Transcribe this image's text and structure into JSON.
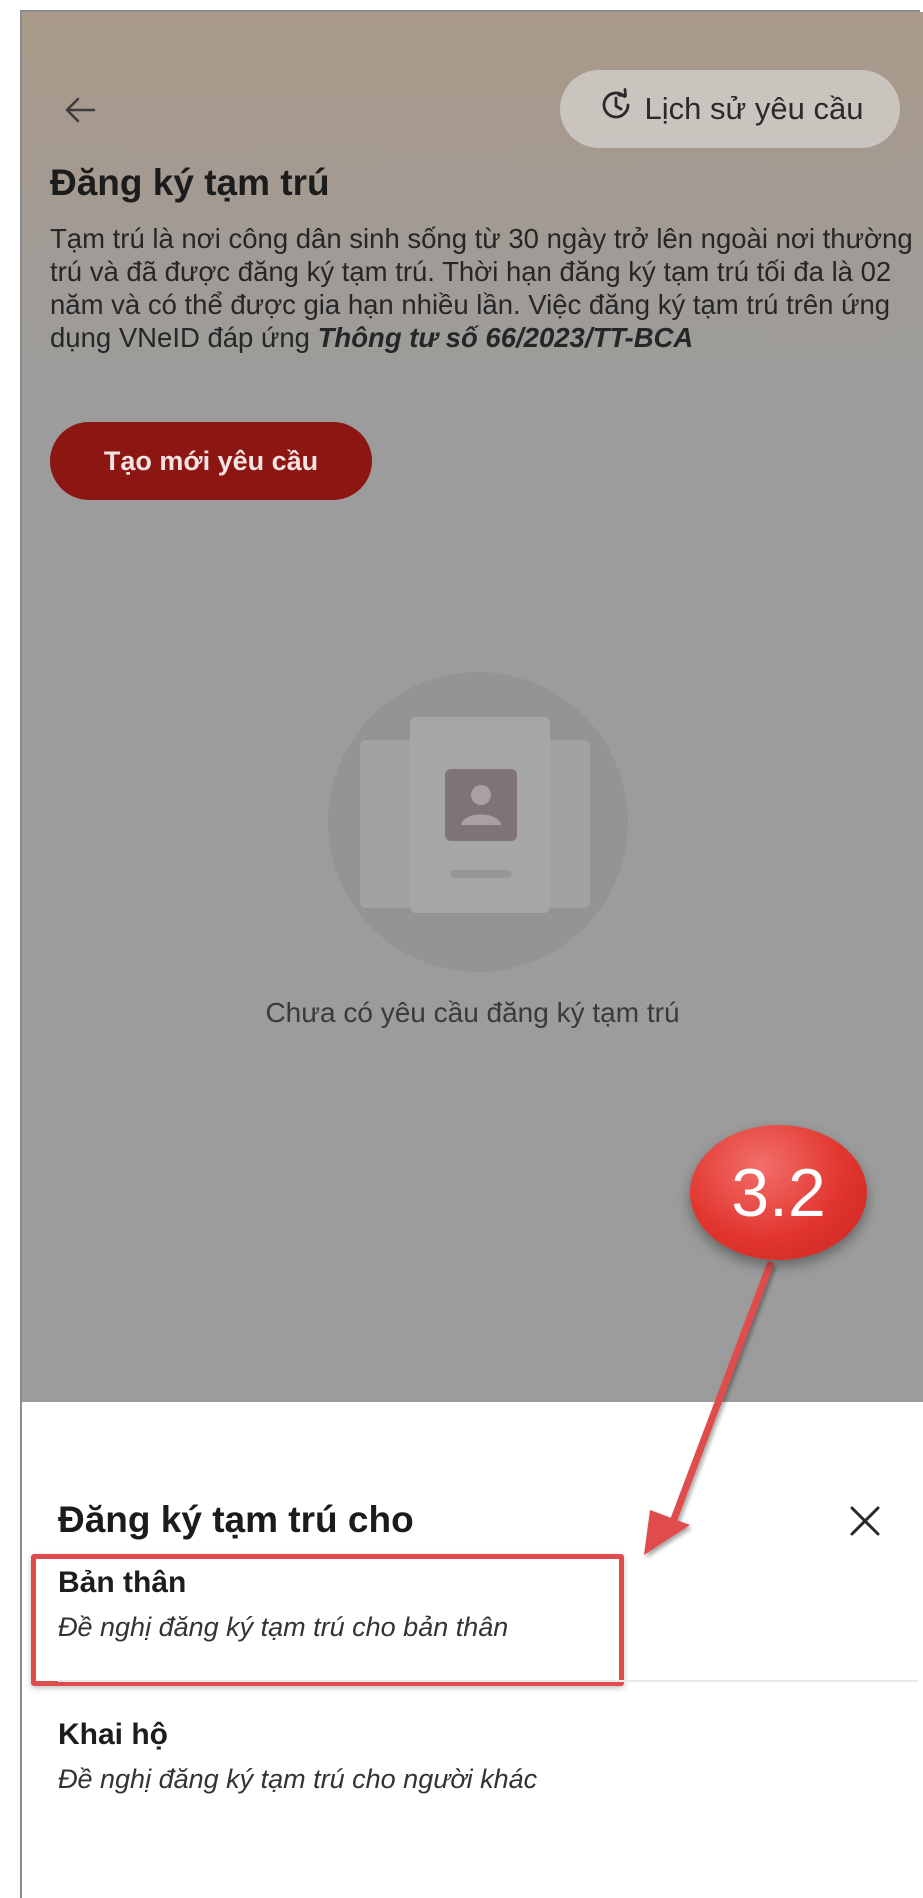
{
  "header": {
    "back_icon": "arrow-left-icon",
    "history_icon": "history-clock-icon",
    "history_label": "Lịch sử yêu cầu"
  },
  "page": {
    "title": "Đăng ký tạm trú",
    "description_plain": "Tạm trú là nơi công dân sinh sống từ 30 ngày trở lên ngoài nơi thường trú và đã được đăng ký tạm trú. Thời hạn đăng ký tạm trú tối đa là 02 năm và có thể được gia hạn nhiều lần. Việc đăng ký tạm trú trên ứng dụng VNeID đáp ứng",
    "description_bold": "Thông tư số 66/2023/TT-BCA",
    "create_button": "Tạo mới yêu cầu",
    "empty_state_icon": "id-card-icon",
    "empty_state_text": "Chưa có yêu cầu đăng ký tạm trú"
  },
  "sheet": {
    "title": "Đăng ký tạm trú cho",
    "close_icon": "close-icon",
    "options": [
      {
        "title": "Bản thân",
        "subtitle": "Đề nghị đăng ký tạm trú cho bản thân"
      },
      {
        "title": "Khai hộ",
        "subtitle": "Đề nghị đăng ký tạm trú cho người khác"
      }
    ]
  },
  "annotation": {
    "step_label": "3.2",
    "color": "#e04b4b"
  },
  "colors": {
    "brand_red": "#8b1612",
    "overlay_gray": "#9b9b9b"
  }
}
